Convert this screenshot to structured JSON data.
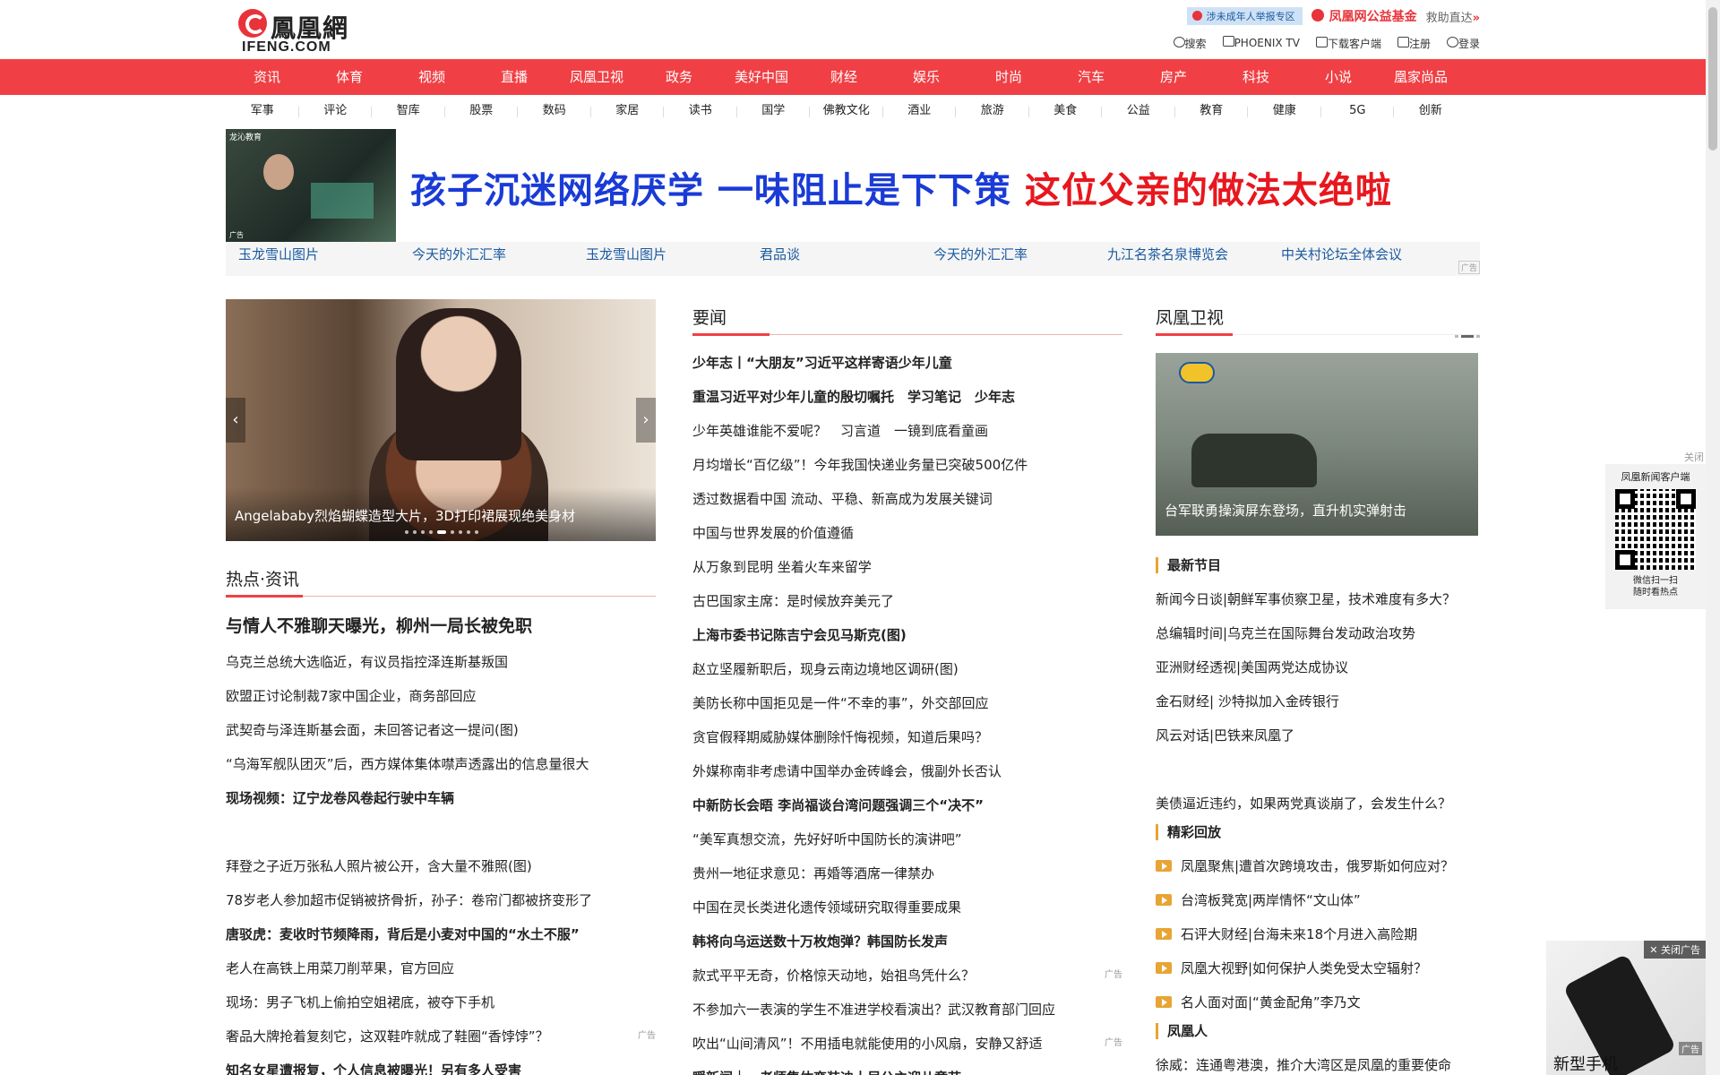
{
  "logo": {
    "cn": "鳳凰網",
    "en": "IFENG.COM"
  },
  "top": {
    "report": "涉未成年人举报专区",
    "fund": "凤凰网公益基金",
    "rescue": "救助直达",
    "actions": [
      "搜索",
      "PHOENIX TV",
      "下载客户端",
      "注册",
      "登录"
    ]
  },
  "nav": [
    "资讯",
    "体育",
    "视频",
    "直播",
    "凤凰卫视",
    "政务",
    "美好中国",
    "财经",
    "娱乐",
    "时尚",
    "汽车",
    "房产",
    "科技",
    "小说",
    "凰家尚品"
  ],
  "subnav": [
    "军事",
    "评论",
    "智库",
    "股票",
    "数码",
    "家居",
    "读书",
    "国学",
    "佛教文化",
    "酒业",
    "旅游",
    "美食",
    "公益",
    "教育",
    "健康",
    "5G",
    "创新"
  ],
  "banner": {
    "tag": "龙沁教育",
    "adtag": "广告",
    "text_blue": "孩子沉迷网络厌学 一味阻止是下下策 ",
    "text_red": "这位父亲的做法太绝啦"
  },
  "adlinks": [
    "玉龙雪山图片",
    "今天的外汇汇率",
    "玉龙雪山图片",
    "君品谈",
    "今天的外汇汇率",
    "九江名茶名泉博览会",
    "中关村论坛全体会议"
  ],
  "adlabel": "广告",
  "slider": {
    "caption": "Angelababy烈焰蝴蝶造型大片，3D打印裙展现绝美身材"
  },
  "hot": {
    "title": "热点·资讯",
    "items": [
      {
        "t": "与情人不雅聊天曝光，柳州一局长被免职",
        "s": "big"
      },
      {
        "t": "乌克兰总统大选临近，有议员指控泽连斯基叛国"
      },
      {
        "t": "欧盟正讨论制裁7家中国企业，商务部回应"
      },
      {
        "t": "武契奇与泽连斯基会面，未回答记者这一提问(图)"
      },
      {
        "t": "“乌海军舰队团灭”后，西方媒体集体噤声透露出的信息量很大"
      },
      {
        "t": "现场视频：辽宁龙卷风卷起行驶中车辆",
        "s": "b"
      },
      {
        "t": "",
        "s": "blank"
      },
      {
        "t": "拜登之子近万张私人照片被公开，含大量不雅照(图)"
      },
      {
        "t": "78岁老人参加超市促销被挤骨折，孙子：卷帘门都被挤变形了"
      },
      {
        "t": "唐驳虎：麦收时节频降雨，背后是小麦对中国的“水土不服”",
        "s": "b"
      },
      {
        "t": "老人在高铁上用菜刀削苹果，官方回应"
      },
      {
        "t": "现场：男子飞机上偷拍空姐裙底，被夺下手机"
      },
      {
        "t": "奢品大牌抢着复刻它，这双鞋咋就成了鞋圈“香饽饽”？",
        "ad": "广告"
      },
      {
        "t": "知名女星遭报复，个人信息被曝光！另有多人受害",
        "s": "b"
      }
    ]
  },
  "news": {
    "title": "要闻",
    "items": [
      {
        "t": "少年志丨“大朋友”习近平这样寄语少年儿童",
        "s": "b"
      },
      {
        "t": "重温习近平对少年儿童的殷切嘱托　学习笔记　少年志",
        "s": "b"
      },
      {
        "t": "少年英雄谁能不爱呢？　习言道　一镜到底看童画"
      },
      {
        "t": "月均增长“百亿级”！今年我国快递业务量已突破500亿件"
      },
      {
        "t": "透过数据看中国 流动、平稳、新高成为发展关键词"
      },
      {
        "t": "中国与世界发展的价值遵循"
      },
      {
        "t": "从万象到昆明 坐着火车来留学"
      },
      {
        "t": "古巴国家主席：是时候放弃美元了"
      },
      {
        "t": "上海市委书记陈吉宁会见马斯克(图)",
        "s": "b"
      },
      {
        "t": "赵立坚履新职后，现身云南边境地区调研(图)"
      },
      {
        "t": "美防长称中国拒见是一件“不幸的事”，外交部回应"
      },
      {
        "t": "贪官假释期威胁媒体删除忏悔视频，知道后果吗？"
      },
      {
        "t": "外媒称南非考虑请中国举办金砖峰会，俄副外长否认"
      },
      {
        "t": "中新防长会晤 李尚福谈台湾问题强调三个“决不”",
        "s": "b"
      },
      {
        "t": "“美军真想交流，先好好听中国防长的演讲吧”"
      },
      {
        "t": "贵州一地征求意见：再婚等酒席一律禁办"
      },
      {
        "t": "中国在灵长类进化遗传领域研究取得重要成果"
      },
      {
        "t": "韩将向乌运送数十万枚炮弹？韩国防长发声",
        "s": "b"
      },
      {
        "t": "款式平平无奇，价格惊天动地，始祖鸟凭什么？",
        "ad": "广告"
      },
      {
        "t": "不参加六一表演的学生不准进学校看演出？武汉教育部门回应"
      },
      {
        "t": "吹出“山间清风”！不用插电就能使用的小风扇，安静又舒适",
        "ad": "广告"
      },
      {
        "t": "瞬新闻｜　老师集体变装迪士尼公主迎儿童节",
        "s": "b"
      }
    ]
  },
  "tv": {
    "title": "凤凰卫视",
    "caption": "台军联勇操演屏东登场，直升机实弹射击",
    "sub1": "最新节目",
    "programs": [
      "新闻今日谈|朝鲜军事侦察卫星，技术难度有多大？",
      "总编辑时间|乌克兰在国际舞台发动政治攻势",
      "亚洲财经透视|美国两党达成协议",
      "金石财经| 沙特拟加入金砖银行",
      "风云对话|巴铁来凤凰了"
    ],
    "extra": "美债逼近违约，如果两党真谈崩了，会发生什么？",
    "sub2": "精彩回放",
    "replays": [
      "凤凰聚焦|遭首次跨境攻击，俄罗斯如何应对？",
      "台湾板凳宽|两岸情怀“文山体”",
      "石评大财经|台海未来18个月进入高险期",
      "凤凰大视野|如何保护人类免受太空辐射？",
      "名人面对面|“黄金配角”李乃文"
    ],
    "sub3": "凤凰人",
    "person": "徐威：连通粤港澳，推介大湾区是凤凰的重要使命"
  },
  "qr": {
    "close": "关闭",
    "t1": "凤凰新闻客户端",
    "t2a": "微信扫一扫",
    "t2b": "随时看热点"
  },
  "phonead": {
    "close": "关闭广告",
    "name": "新型手机",
    "ad": "广告"
  }
}
